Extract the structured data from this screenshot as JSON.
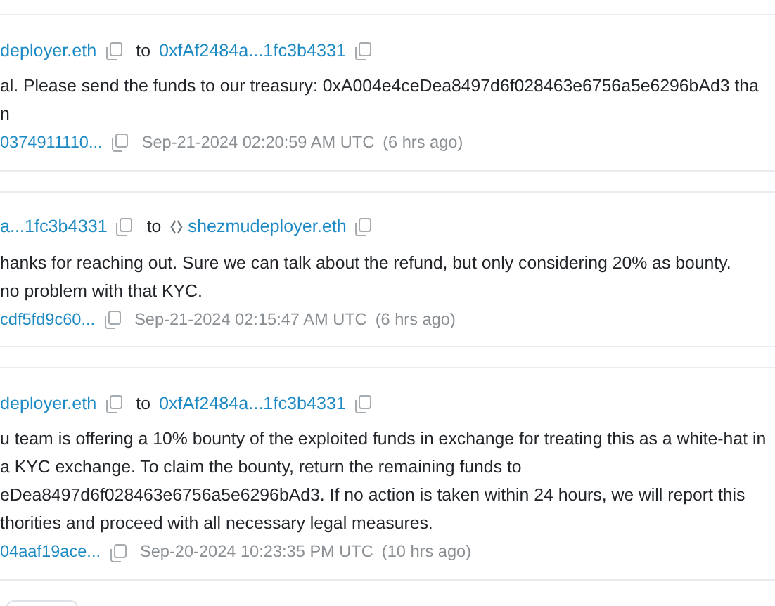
{
  "messages": [
    {
      "from": "deployer.eth",
      "to_word": "to",
      "to": {
        "text": "0xfAf2484a...1fc3b4331",
        "icon": false
      },
      "lines": [
        "al. Please send the funds to our treasury: 0xA004e4ceDea8497d6f028463e6756a5e6296bAd3 tha",
        "n"
      ],
      "tx": "0374911110...",
      "time": "Sep-21-2024 02:20:59 AM UTC",
      "ago": "(6 hrs ago)"
    },
    {
      "from": "a...1fc3b4331",
      "to_word": "to",
      "to": {
        "text": "shezmudeployer.eth",
        "icon": true
      },
      "lines": [
        "hanks for reaching out. Sure we can talk about the refund, but only considering 20% as bounty.",
        "no problem with that KYC."
      ],
      "tx": "cdf5fd9c60...",
      "time": "Sep-21-2024 02:15:47 AM UTC",
      "ago": "(6 hrs ago)"
    },
    {
      "from": "deployer.eth",
      "to_word": "to",
      "to": {
        "text": "0xfAf2484a...1fc3b4331",
        "icon": false
      },
      "lines": [
        "u team is offering a 10% bounty of the exploited funds in exchange for treating this as a white-hat in",
        "a KYC exchange. To claim the bounty, return the remaining funds to",
        "eDea8497d6f028463e6756a5e6296bAd3. If no action is taken within 24 hours, we will report this",
        "thorities and proceed with all necessary legal measures."
      ],
      "tx": "04aaf19ace...",
      "time": "Sep-20-2024 10:23:35 PM UTC",
      "ago": "(10 hrs ago)"
    }
  ]
}
